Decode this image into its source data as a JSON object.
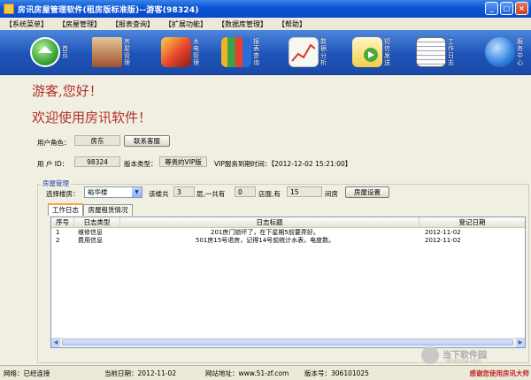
{
  "window": {
    "title": "房讯房屋管理软件(租房版标准版)--游客(98324)"
  },
  "menu": [
    "【系统菜单】",
    "【房屋管理】",
    "【报表查询】",
    "【扩展功能】",
    "【数据库管理】",
    "【帮助】"
  ],
  "toolbar": {
    "home": "首页",
    "rooms": "房屋管理",
    "utility": "水电管理",
    "report": "报表查询",
    "analysis": "数据分析",
    "sms": "短信发送",
    "log": "工作日志",
    "service": "服务中心"
  },
  "greeting": {
    "line1": "游客,您好！",
    "line2": "欢迎使用房讯软件！"
  },
  "user": {
    "role_label": "用户角色：",
    "role": "房东",
    "contact_btn": "联系客服",
    "id_label": "用 户 ID：",
    "id": "98324",
    "version_label": "版本类型：",
    "version": "尊贵的VIP版",
    "vip_text": "VIP服务到期时间：【2012-12-02 15:21:00】"
  },
  "house": {
    "group_title": "房屋管理",
    "select_label": "选择楼房：",
    "building": "裕华楼",
    "floors_label": "该楼共",
    "floors": "3",
    "shops_label": "层,一共有",
    "shops": "0",
    "rooms_label": "店面,有",
    "rooms": "15",
    "rooms_unit": "间房",
    "setting_btn": "房屋设置"
  },
  "tabs": [
    "工作日志",
    "房屋租赁情况"
  ],
  "table": {
    "columns": [
      "序号",
      "日志类型",
      "日志标题",
      "登记日期"
    ],
    "rows": [
      {
        "no": "1",
        "type": "维修信息",
        "title": "201房门锁坏了，在下星期5前要弄好。",
        "date": "2012-11-02"
      },
      {
        "no": "2",
        "type": "费用信息",
        "title": "501房15号退房，记得14号前统计水表，电度数。",
        "date": "2012-11-02"
      }
    ]
  },
  "status": {
    "network": "网络：已经连接",
    "date": "当前日期：2012-11-02",
    "site": "网站地址：www.51-zf.com",
    "version_no": "版本号：306101025",
    "slogan": "感谢您使用房讯大师"
  },
  "watermark": {
    "text": "当下软件园",
    "url": "downxia.com"
  },
  "colors": {
    "accent": "#b0302a",
    "titlebar": "#0a54d6"
  }
}
